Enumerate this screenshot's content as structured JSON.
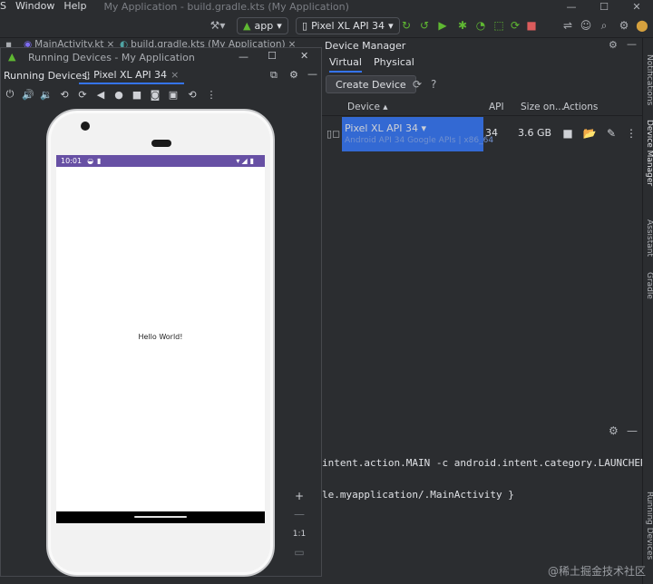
{
  "menu": {
    "items": [
      "S",
      "Window",
      "Help"
    ],
    "window_title": "My Application - build.gradle.kts (My Application)"
  },
  "toolbar": {
    "run_config": "app",
    "device_combo": "Pixel XL API 34"
  },
  "editor_tabs": [
    "MainActivity.kt",
    "build.gradle.kts (My Application)"
  ],
  "running_devices": {
    "window_title": "Running Devices - My Application",
    "label": "Running Devices:",
    "tab": "Pixel XL API 34"
  },
  "phone": {
    "time": "10:01",
    "hello": "Hello World!"
  },
  "zoom": {
    "one_to_one": "1:1"
  },
  "device_manager": {
    "title": "Device Manager",
    "tabs": [
      "Virtual",
      "Physical"
    ],
    "create_button": "Create Device",
    "columns": {
      "device": "Device",
      "api": "API",
      "size": "Size on...",
      "actions": "Actions"
    },
    "device": {
      "name": "Pixel XL API 34",
      "sub": "Android API 34 Google APIs | x86_64",
      "api": "34",
      "size": "3.6 GB"
    }
  },
  "logcat": {
    "line1": "intent.action.MAIN -c android.intent.category.LAUNCHER --",
    "line2": "le.myapplication/.MainActivity }"
  },
  "right_strip": [
    "Notifications",
    "Device Manager",
    "Assistant",
    "Gradle",
    "Running Devices"
  ],
  "watermark": "@稀土掘金技术社区",
  "colors": {
    "accent": "#3574f0",
    "status_bar": "#6750a4",
    "run_green": "#5fb832",
    "stop_red": "#db5c5c"
  }
}
